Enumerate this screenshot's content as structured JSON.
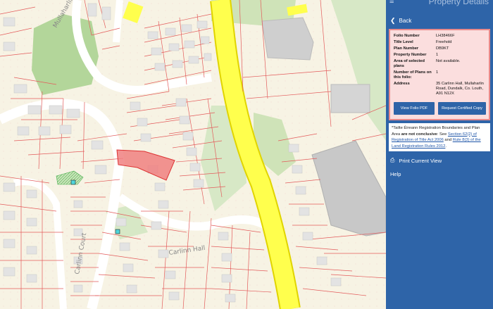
{
  "panel": {
    "title": "Property Details",
    "back_label": "Back",
    "menu_icon": "hamburger-menu-icon",
    "properties": [
      {
        "key": "Folio Number",
        "value": "LH38466F"
      },
      {
        "key": "Title Level",
        "value": "Freehold"
      },
      {
        "key": "Plan Number",
        "value": "DB9KT"
      },
      {
        "key": "Property Number",
        "value": "1"
      },
      {
        "key": "Area of selected plans",
        "value": "Not available."
      },
      {
        "key": "Number of Plans on this folio:",
        "value": "1"
      },
      {
        "key": "Address",
        "value": "35 Carlinn Hall, Mullaharlin Road, Dundalk, Co. Louth, A91 N12X"
      }
    ],
    "view_pdf_label": "View Folio PDF",
    "certified_copy_label": "Request Certified Copy",
    "notice": {
      "prefix": "*Tailte Éireann Registration Boundaries and Plan Area ",
      "bold": "are not conclusive",
      "middle": ": See ",
      "link1": "Section 62(2) of Registration of Title Act 2006",
      "and": " and ",
      "link2": "Rule 8(3) of the Land Registration Rules 2012",
      "suffix": "."
    },
    "print_label": "Print Current View",
    "help_label": "Help",
    "colors": {
      "panel_bg": "#2e64a8",
      "info_bg": "#fbdede",
      "info_border": "#e98a8a"
    }
  },
  "map": {
    "road_labels": [
      "Mullaharlin",
      "Carlinn Court",
      "Carlinn Hall"
    ],
    "colors": {
      "road": "#ffff4d",
      "boundary": "#e35b5b",
      "selected_parcel": "#f08080",
      "green_area": "#a9d08e",
      "building": "#d9d9d9",
      "background": "#f5f2e6"
    }
  }
}
